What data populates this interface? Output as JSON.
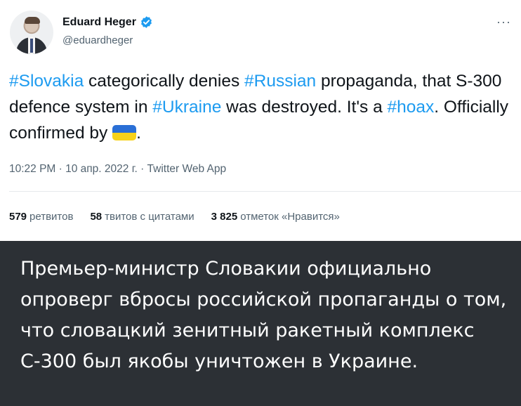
{
  "tweet": {
    "author_name": "Eduard Heger",
    "author_handle": "@eduardheger",
    "more_label": "···",
    "text": {
      "tag1": "#Slovakia",
      "t1": " categorically denies ",
      "tag2": "#Russian",
      "t2": " propaganda, that S-300 defence system in ",
      "tag3": "#Ukraine",
      "t3": " was destroyed. It's a ",
      "tag4": "#hoax",
      "t4": ". Officially confirmed by ",
      "t5": "."
    },
    "timestamp": "10:22 PM · 10 апр. 2022 г. · Twitter Web App",
    "stats": {
      "retweets_count": "579",
      "retweets_label": "ретвитов",
      "quotes_count": "58",
      "quotes_label": "твитов с цитатами",
      "likes_count": "3 825",
      "likes_label": "отметок «Нравится»"
    },
    "flag_icon": "ukraine-flag-emoji",
    "colors": {
      "link": "#1d9bf0",
      "verified": "#1d9bf0",
      "flag_blue": "#2a6fd6",
      "flag_yellow": "#f7d21a"
    }
  },
  "caption": {
    "text": "Премьер-министр Словакии официально опроверг вбросы российской пропаганды о том, что словацкий зенитный ракетный комплекс С-300 был якобы уничтожен в Украине."
  }
}
